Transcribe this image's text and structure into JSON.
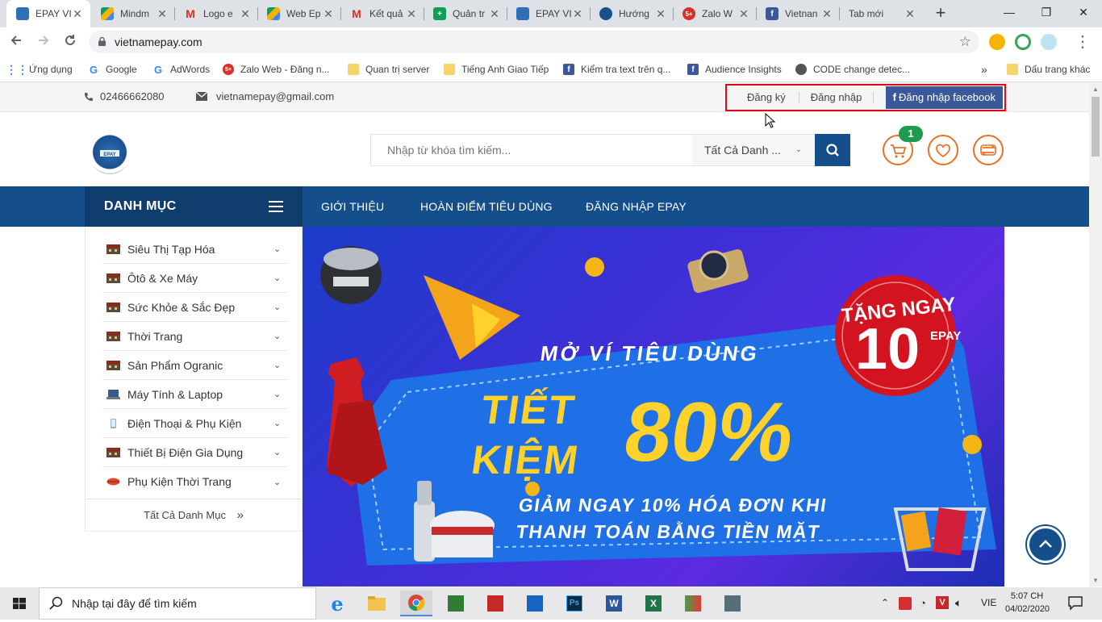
{
  "browser": {
    "tabs": [
      {
        "title": "EPAY VI",
        "icon": "epay-icon",
        "active": true
      },
      {
        "title": "Mindm",
        "icon": "google-drive-icon"
      },
      {
        "title": "Logo e",
        "icon": "gmail-icon"
      },
      {
        "title": "Web Ep",
        "icon": "google-drive-icon"
      },
      {
        "title": "Kết quả",
        "icon": "gmail-icon"
      },
      {
        "title": "Quản tr",
        "icon": "sheets-icon"
      },
      {
        "title": "EPAY VI",
        "icon": "epay-icon"
      },
      {
        "title": "Hướng",
        "icon": "user-icon"
      },
      {
        "title": "Zalo W",
        "icon": "zalo-icon"
      },
      {
        "title": "Vietnan",
        "icon": "facebook-icon"
      },
      {
        "title": "Tab mới",
        "icon": ""
      }
    ],
    "url": "vietnamepay.com",
    "bookmarks": [
      {
        "label": "Ứng dụng",
        "icon": "apps-grid-icon"
      },
      {
        "label": "Google",
        "icon": "google-icon"
      },
      {
        "label": "AdWords",
        "icon": "google-icon"
      },
      {
        "label": "Zalo Web - Đăng n...",
        "icon": "zalo-icon"
      },
      {
        "label": "Quan trị server",
        "icon": "folder-icon"
      },
      {
        "label": "Tiếng Anh Giao Tiếp",
        "icon": "folder-icon"
      },
      {
        "label": "Kiểm tra text trên q...",
        "icon": "facebook-icon"
      },
      {
        "label": "Audience Insights",
        "icon": "facebook-icon"
      },
      {
        "label": "CODE change detec...",
        "icon": "code-icon"
      },
      {
        "label": "»",
        "icon": ""
      },
      {
        "label": "Dấu trang khác",
        "icon": "folder-icon"
      }
    ]
  },
  "topbar": {
    "phone": "02466662080",
    "email": "vietnamepay@gmail.com",
    "register": "Đăng ký",
    "login": "Đăng nhập",
    "facebook_login": "Đăng nhập facebook"
  },
  "header": {
    "search_placeholder": "Nhập từ khóa tìm kiếm...",
    "category_select": "Tất Cả Danh ...",
    "cart_count": "1"
  },
  "nav": {
    "danh_muc": "DANH MỤC",
    "items": [
      "GIỚI THIỆU",
      "HOÀN ĐIỂM TIÊU DÙNG",
      "ĐĂNG NHẬP EPAY"
    ]
  },
  "sidebar": {
    "categories": [
      {
        "label": "Siêu Thị Tạp Hóa",
        "icon": "store-icon"
      },
      {
        "label": "Ôtô & Xe Máy",
        "icon": "store-icon"
      },
      {
        "label": "Sức Khỏe & Sắc Đẹp",
        "icon": "store-icon"
      },
      {
        "label": "Thời Trang",
        "icon": "store-icon"
      },
      {
        "label": "Sản Phẩm Ogranic",
        "icon": "store-icon"
      },
      {
        "label": "Máy Tính & Laptop",
        "icon": "laptop-icon"
      },
      {
        "label": "Điện Thoại & Phụ Kiện",
        "icon": "phone-icon"
      },
      {
        "label": "Thiết Bị Điện Gia Dụng",
        "icon": "store-icon"
      },
      {
        "label": "Phụ Kiện Thời Trang",
        "icon": "lips-icon"
      }
    ],
    "all": "Tất Cả Danh Mục"
  },
  "banner": {
    "line1": "MỞ VÍ TIÊU DÙNG",
    "line2": "TIẾT",
    "line3": "KIỆM",
    "percent": "80%",
    "line4": "GIẢM NGAY 10% HÓA ĐƠN KHI",
    "line5": "THANH TOÁN BẰNG TIỀN MẶT",
    "badge_top": "TẶNG NGAY",
    "badge_num": "10",
    "badge_unit": "EPAY"
  },
  "taskbar": {
    "search_placeholder": "Nhập tại đây để tìm kiếm",
    "lang": "VIE",
    "time": "5:07 CH",
    "date": "04/02/2020"
  },
  "colors": {
    "primary": "#154f8b",
    "dark": "#0e3d6e",
    "accent": "#e97125",
    "facebook": "#3b5998",
    "highlight": "#e30613"
  }
}
